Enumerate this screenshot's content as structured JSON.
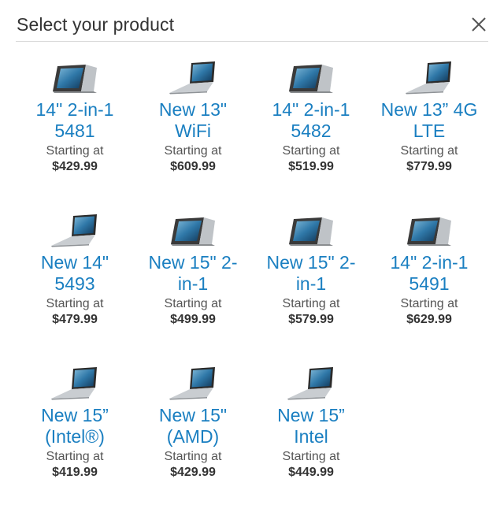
{
  "dialog": {
    "title": "Select your product",
    "close_icon": "close-icon"
  },
  "products": [
    {
      "name": "14\" 2-in-1\n5481",
      "starting_label": "Starting at",
      "price": "$429.99",
      "image": "convertible-laptop"
    },
    {
      "name": "New 13\"\nWiFi",
      "starting_label": "Starting at",
      "price": "$609.99",
      "image": "open-laptop"
    },
    {
      "name": "14\" 2-in-1\n5482",
      "starting_label": "Starting at",
      "price": "$519.99",
      "image": "convertible-laptop"
    },
    {
      "name": "New 13” 4G\nLTE",
      "starting_label": "Starting at",
      "price": "$779.99",
      "image": "open-laptop"
    },
    {
      "name": "New 14\"\n5493",
      "starting_label": "Starting at",
      "price": "$479.99",
      "image": "open-laptop"
    },
    {
      "name": "New 15\" 2-\nin-1",
      "starting_label": "Starting at",
      "price": "$499.99",
      "image": "convertible-laptop"
    },
    {
      "name": "New 15\" 2-\nin-1",
      "starting_label": "Starting at",
      "price": "$579.99",
      "image": "convertible-laptop"
    },
    {
      "name": "14\" 2-in-1\n5491",
      "starting_label": "Starting at",
      "price": "$629.99",
      "image": "convertible-laptop"
    },
    {
      "name": "New 15”\n(Intel®)",
      "starting_label": "Starting at",
      "price": "$419.99",
      "image": "open-laptop"
    },
    {
      "name": "New 15\"\n(AMD)",
      "starting_label": "Starting at",
      "price": "$429.99",
      "image": "open-laptop"
    },
    {
      "name": "New 15”\nIntel",
      "starting_label": "Starting at",
      "price": "$449.99",
      "image": "open-laptop"
    }
  ]
}
